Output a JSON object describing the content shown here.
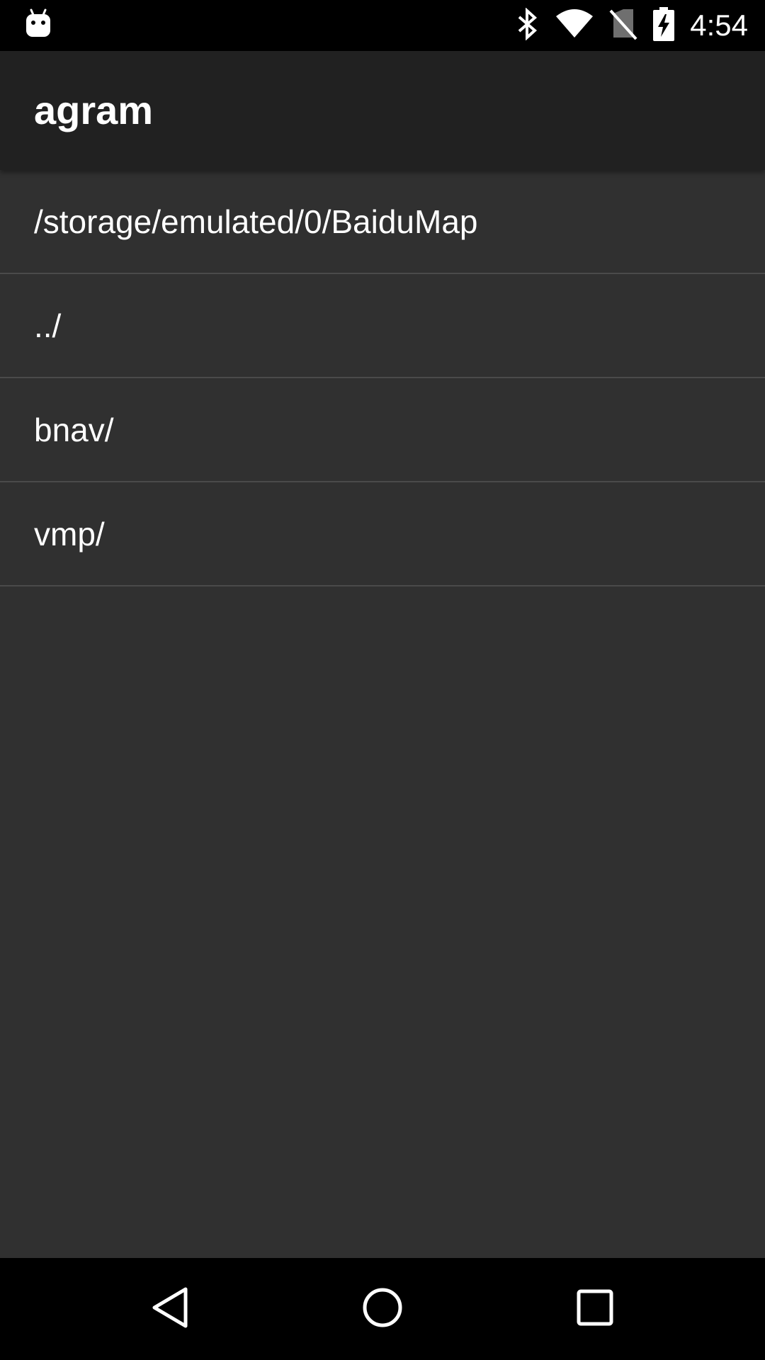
{
  "status_bar": {
    "time": "4:54",
    "icons": [
      "android-notification-icon",
      "bluetooth-icon",
      "wifi-icon",
      "no-sim-icon",
      "battery-charging-icon"
    ]
  },
  "app_bar": {
    "title": "agram"
  },
  "file_list": {
    "current_path": "/storage/emulated/0/BaiduMap",
    "items": [
      {
        "label": "../"
      },
      {
        "label": "bnav/"
      },
      {
        "label": "vmp/"
      }
    ]
  },
  "nav_bar": {
    "buttons": [
      "back-icon",
      "home-icon",
      "recents-icon"
    ]
  },
  "colors": {
    "background": "#303030",
    "app_bar": "#212121",
    "status_bar": "#000000",
    "divider": "#4a4a4a",
    "text": "#ffffff"
  }
}
